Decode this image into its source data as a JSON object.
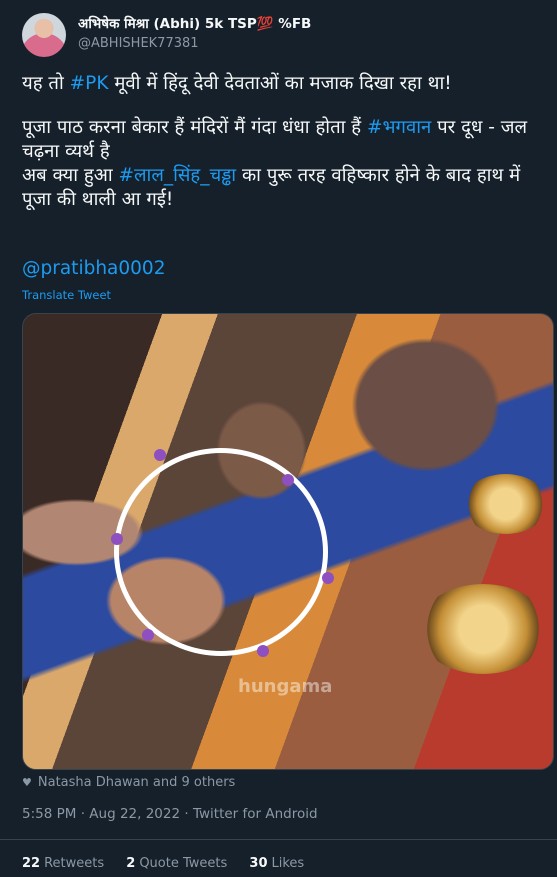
{
  "tweet": {
    "author_name": "अभिषेक मिश्रा (Abhi) 5k TSP💯 %FB",
    "author_handle": "@ABHISHEK77381",
    "line1_pre": "यह तो ",
    "line1_tag": "#PK",
    "line1_post": " मूवी में हिंदू देवी देवताओं का मजाक दिखा रहा था!",
    "line2_pre": "पूजा पाठ करना बेकार हैं मंदिरों मैं गंदा धंधा होता हैं ",
    "line2_tag": "#भगवान",
    "line2_post": " पर दूध - जल चढ़ना व्यर्थ है",
    "line3_pre": "अब क्या हुआ ",
    "line3_tag": "#लाल_सिंह_चड्ढा",
    "line3_post": " का पुरू तरह वहिष्कार होने के बाद हाथ में पूजा की थाली आ गई!",
    "mention": "@pratibha0002",
    "translate_label": "Translate Tweet",
    "watermark": "hungama",
    "liked_by": "Natasha Dhawan and 9 others",
    "time": "5:58 PM",
    "date": "Aug 22, 2022",
    "source": "Twitter for Android",
    "separator": "·"
  },
  "stats": {
    "retweets_count": "22",
    "retweets_label": "Retweets",
    "quotes_count": "2",
    "quotes_label": "Quote Tweets",
    "likes_count": "30",
    "likes_label": "Likes"
  },
  "icons": {
    "liked_by": "heart-icon",
    "avatar": "profile-avatar"
  }
}
